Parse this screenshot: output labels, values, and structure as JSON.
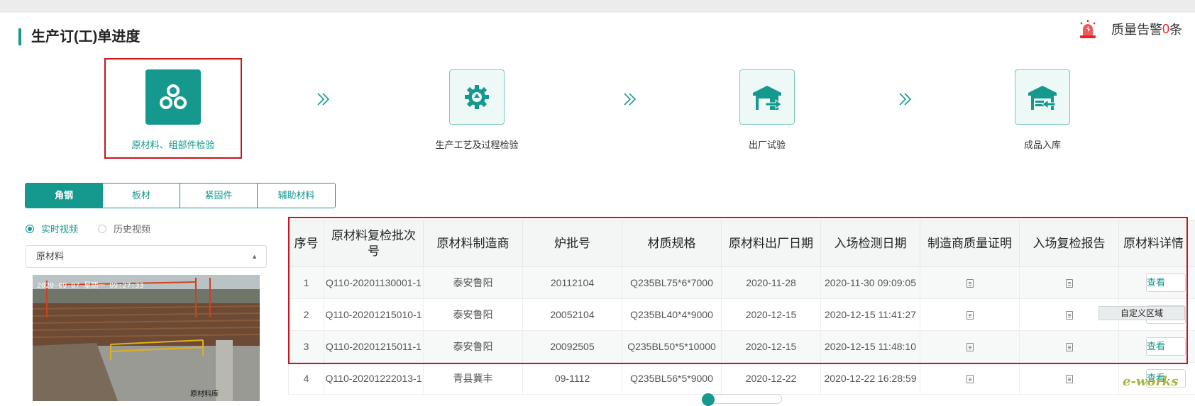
{
  "header": {
    "title": "生产订(工)单进度",
    "alert_prefix": "质量告警",
    "alert_count": "0",
    "alert_suffix": "条",
    "alert_icon": "alarm-light-icon"
  },
  "steps": [
    {
      "label": "原材料、组部件检验",
      "icon": "three-circles-icon",
      "active": true
    },
    {
      "label": "生产工艺及过程检验",
      "icon": "gear-icon",
      "active": false
    },
    {
      "label": "出厂试验",
      "icon": "warehouse-out-icon",
      "active": false
    },
    {
      "label": "成品入库",
      "icon": "warehouse-in-icon",
      "active": false
    }
  ],
  "tabs": [
    "角钢",
    "板材",
    "紧固件",
    "辅助材料"
  ],
  "video_mode": {
    "live": "实时视频",
    "history": "历史视频"
  },
  "select": {
    "value": "原材料"
  },
  "video": {
    "timestamp": "2020-09-07 星期一 09:27:33",
    "caption": "原材料库"
  },
  "table": {
    "headers": [
      "序号",
      "原材料复检批次号",
      "原材料制造商",
      "炉批号",
      "材质规格",
      "原材料出厂日期",
      "入场检测日期",
      "制造商质量证明",
      "入场复检报告",
      "原材料详情"
    ],
    "view_label": "查看",
    "rows": [
      [
        "1",
        "Q110-20201130001-1",
        "泰安鲁阳",
        "20112104",
        "Q235BL75*6*7000",
        "2020-11-28",
        "2020-11-30 09:09:05"
      ],
      [
        "2",
        "Q110-20201215010-1",
        "泰安鲁阳",
        "20052104",
        "Q235BL40*4*9000",
        "2020-12-15",
        "2020-12-15 11:41:27"
      ],
      [
        "3",
        "Q110-20201215011-1",
        "泰安鲁阳",
        "20092505",
        "Q235BL50*5*10000",
        "2020-12-15",
        "2020-12-15 11:48:10"
      ],
      [
        "4",
        "Q110-20201222013-1",
        "青县冀丰",
        "09-1112",
        "Q235BL56*5*9000",
        "2020-12-22",
        "2020-12-22 16:28:59"
      ]
    ]
  },
  "tooltip": "自定义区域",
  "watermark": "e-works",
  "colors": {
    "accent": "#15998e",
    "highlight": "#c9151e",
    "alert": "#e0282d"
  }
}
